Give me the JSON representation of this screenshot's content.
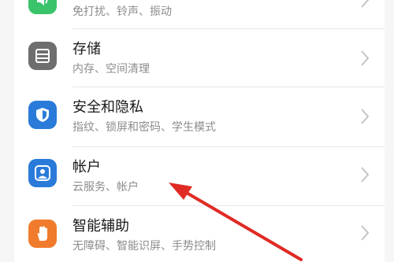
{
  "colors": {
    "sound_icon": "#3ac36b",
    "storage_icon": "#6e6e6e",
    "security_icon": "#2a7bd9",
    "account_icon": "#2a7bd9",
    "assist_icon": "#f07b2c",
    "annotation_arrow": "#e02a24"
  },
  "settings": {
    "items": [
      {
        "title": "",
        "subtitle": "免打扰、铃声、振动",
        "icon": "sound-icon"
      },
      {
        "title": "存储",
        "subtitle": "内存、空间清理",
        "icon": "storage-icon"
      },
      {
        "title": "安全和隐私",
        "subtitle": "指纹、锁屏和密码、学生模式",
        "icon": "shield-icon"
      },
      {
        "title": "帐户",
        "subtitle": "云服务、帐户",
        "icon": "account-icon"
      },
      {
        "title": "智能辅助",
        "subtitle": "无障碍、智能识屏、手势控制",
        "icon": "hand-icon"
      }
    ]
  }
}
